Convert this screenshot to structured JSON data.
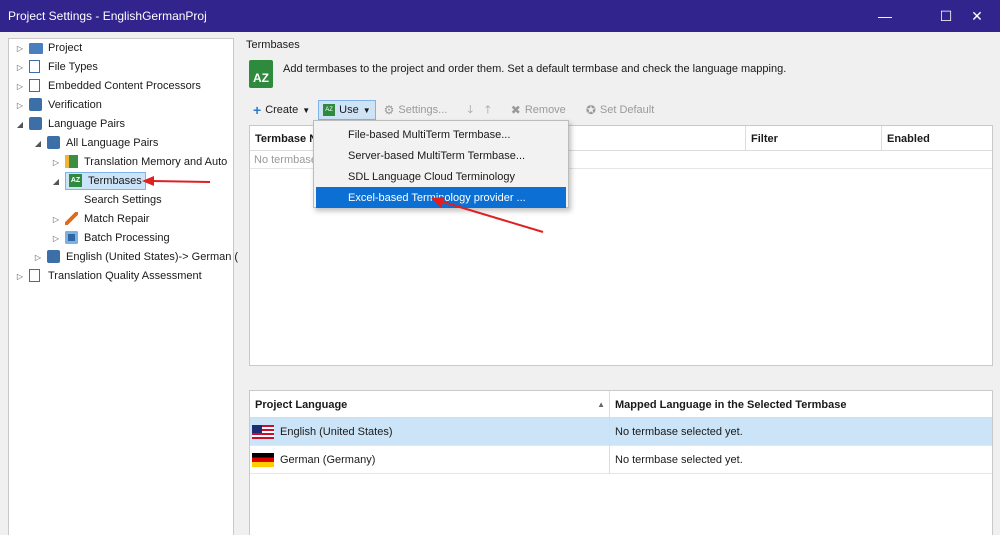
{
  "window": {
    "title": "Project Settings - EnglishGermanProj",
    "minimize": "—",
    "maximize": "☐",
    "close": "✕"
  },
  "tree": {
    "items": [
      {
        "label": "Project",
        "icon": "project-icon"
      },
      {
        "label": "File Types",
        "icon": "file-types-icon"
      },
      {
        "label": "Embedded Content Processors",
        "icon": "processor-icon"
      },
      {
        "label": "Verification",
        "icon": "verification-icon"
      },
      {
        "label": "Language Pairs",
        "icon": "language-pairs-icon"
      },
      {
        "label": "All Language Pairs",
        "icon": "language-pairs-icon"
      },
      {
        "label": "Translation Memory and Auto",
        "icon": "translation-memory-icon"
      },
      {
        "label": "Termbases",
        "icon": "termbase-icon"
      },
      {
        "label": "Search Settings",
        "icon": ""
      },
      {
        "label": "Match Repair",
        "icon": "wrench-icon"
      },
      {
        "label": "Batch Processing",
        "icon": "batch-processing-icon"
      },
      {
        "label": "English (United States)-> German (",
        "icon": "language-pairs-icon"
      },
      {
        "label": "Translation Quality Assessment",
        "icon": "tqa-icon"
      }
    ]
  },
  "main": {
    "section_title": "Termbases",
    "az_icon_text": "AZ",
    "description": "Add termbases to the project and order them. Set a default termbase and check the language mapping.",
    "toolbar": {
      "create": "Create",
      "use": "Use",
      "settings": "Settings...",
      "remove": "Remove",
      "set_default": "Set Default"
    },
    "termbase_grid": {
      "columns": [
        "Termbase N",
        "Filter",
        "Enabled"
      ],
      "empty_text": "No termbase"
    },
    "use_menu": {
      "items": [
        "File-based MultiTerm Termbase...",
        "Server-based MultiTerm Termbase...",
        "SDL Language Cloud Terminology",
        "Excel-based Terminology provider ..."
      ]
    },
    "language_grid": {
      "columns": [
        "Project Language",
        "Mapped Language in the Selected Termbase"
      ],
      "rows": [
        {
          "language": "English (United States)",
          "mapped": "No termbase selected yet."
        },
        {
          "language": "German (Germany)",
          "mapped": "No termbase selected yet."
        }
      ]
    }
  },
  "colors": {
    "titlebar": "#31248c",
    "selection": "#cce4f7",
    "menu_highlight": "#0b6fd3",
    "annotation_arrow": "#e02020"
  }
}
